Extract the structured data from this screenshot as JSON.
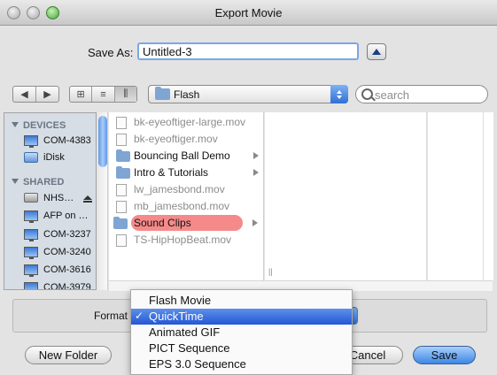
{
  "window": {
    "title": "Export Movie"
  },
  "save_as": {
    "label": "Save As:",
    "value": "Untitled-3"
  },
  "toolbar": {
    "back": "◀",
    "forward": "▶",
    "view_icon": "⊞",
    "view_list": "≡",
    "view_columns": "⫼",
    "location": "Flash",
    "search_placeholder": "search"
  },
  "sidebar": {
    "devices_header": "DEVICES",
    "shared_header": "SHARED",
    "devices": [
      {
        "label": "COM-4383",
        "icon": "computer-icon"
      },
      {
        "label": "iDisk",
        "icon": "idisk-icon"
      }
    ],
    "shared": [
      {
        "label": "NHS…",
        "icon": "server-icon"
      },
      {
        "label": "AFP on …",
        "icon": "computer-icon"
      },
      {
        "label": "COM-3237",
        "icon": "computer-icon"
      },
      {
        "label": "COM-3240",
        "icon": "computer-icon"
      },
      {
        "label": "COM-3616",
        "icon": "computer-icon"
      },
      {
        "label": "COM-3979",
        "icon": "computer-icon"
      }
    ]
  },
  "files": [
    {
      "name": "bk-eyeoftiger-large.mov",
      "type": "file",
      "dim": true
    },
    {
      "name": "bk-eyeoftiger.mov",
      "type": "file",
      "dim": true
    },
    {
      "name": "Bouncing Ball Demo",
      "type": "folder",
      "dim": false
    },
    {
      "name": "Intro & Tutorials",
      "type": "folder",
      "dim": false
    },
    {
      "name": "lw_jamesbond.mov",
      "type": "file",
      "dim": true
    },
    {
      "name": "mb_jamesbond.mov",
      "type": "file",
      "dim": true
    },
    {
      "name": "Sound Clips",
      "type": "folder",
      "dim": false,
      "selected": true
    },
    {
      "name": "TS-HipHopBeat.mov",
      "type": "file",
      "dim": true
    }
  ],
  "format": {
    "label": "Format",
    "options": [
      "Flash Movie",
      "QuickTime",
      "Animated GIF",
      "PICT Sequence",
      "EPS 3.0 Sequence"
    ],
    "selected": "QuickTime",
    "check": "✓"
  },
  "buttons": {
    "new_folder": "New Folder",
    "cancel": "Cancel",
    "save": "Save"
  },
  "colors": {
    "selection": "#2457d4",
    "label_red": "#f58a8a",
    "accent": "#3d86e5"
  }
}
